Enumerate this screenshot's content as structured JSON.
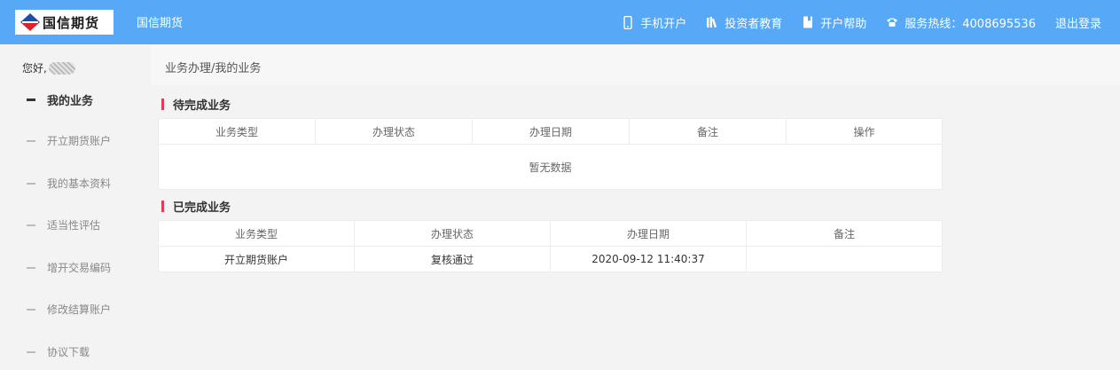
{
  "header": {
    "logo_text": "国信期货",
    "brand": "国信期货",
    "nav": [
      {
        "label": "手机开户",
        "icon": "mobile-icon"
      },
      {
        "label": "投资者教育",
        "icon": "books-icon"
      },
      {
        "label": "开户帮助",
        "icon": "bookmark-icon"
      },
      {
        "label": "服务热线：4008695536",
        "icon": "phone-icon"
      },
      {
        "label": "退出登录",
        "icon": ""
      }
    ]
  },
  "sidebar": {
    "greeting": "您好,",
    "items": [
      {
        "label": "我的业务",
        "active": true
      },
      {
        "label": "开立期货账户",
        "active": false
      },
      {
        "label": "我的基本资料",
        "active": false
      },
      {
        "label": "适当性评估",
        "active": false
      },
      {
        "label": "增开交易编码",
        "active": false
      },
      {
        "label": "修改结算账户",
        "active": false
      },
      {
        "label": "协议下载",
        "active": false
      }
    ]
  },
  "main": {
    "breadcrumb": "业务办理/我的业务",
    "pending": {
      "title": "待完成业务",
      "columns": [
        "业务类型",
        "办理状态",
        "办理日期",
        "备注",
        "操作"
      ],
      "empty_text": "暂无数据"
    },
    "completed": {
      "title": "已完成业务",
      "columns": [
        "业务类型",
        "办理状态",
        "办理日期",
        "备注"
      ],
      "rows": [
        [
          "开立期货账户",
          "复核通过",
          "2020-09-12 11:40:37",
          ""
        ]
      ]
    }
  },
  "colors": {
    "header_bg": "#57a9f7",
    "accent": "#e63a57"
  }
}
